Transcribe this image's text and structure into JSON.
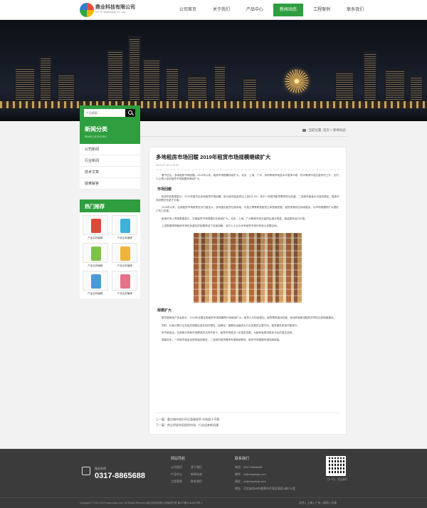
{
  "header": {
    "company_name": "鼎业科技有限公司",
    "company_sub": "Chi Ye Technology Co., Ltd.",
    "nav": [
      "公司首页",
      "关于我们",
      "产品中心",
      "新闻动态",
      "工程案例",
      "联系我们"
    ],
    "active_nav": "新闻动态"
  },
  "search": {
    "placeholder": "产品搜索"
  },
  "sidebar": {
    "title": "新闻分类",
    "subtitle": "NEWS CATEGORY",
    "items": [
      "公司新闻",
      "行业新闻",
      "技术文章",
      "疑难解答"
    ],
    "hot_title": "热门推荐",
    "products": [
      {
        "label": "产品名称编辑",
        "color": "#d94b3c"
      },
      {
        "label": "产品名称编辑",
        "color": "#3fb0d9"
      },
      {
        "label": "产品名称编辑",
        "color": "#7fc24b"
      },
      {
        "label": "产品名称编辑",
        "color": "#f0b43c"
      },
      {
        "label": "产品名称编辑",
        "color": "#4a9bd4"
      },
      {
        "label": "产品名称编辑",
        "color": "#e6728a"
      }
    ]
  },
  "breadcrumb": {
    "prefix": "当前位置:",
    "home": "首页",
    "current": "新闻动态"
  },
  "article": {
    "title": "多地租房市场回暖 2019年租赁市场规模继续扩大",
    "date": "2019-07-19 11:32:45",
    "intro": "春节过后，多地租房市场回暖。2019年以来，租房市场规模持续扩大，北京、上海、广州、深圳等城市租金水平整体平稳，杭州等城市成交量有所上升，业内人士预计全年租赁市场规模将继续扩大。",
    "section1": "市场回暖",
    "para1": "相关机构数据显示，2019年春节后多地租赁市场回暖，部分城市租金同比上涨约1.3%，其中一线城市租赁需求较为旺盛，二线城市租金水平保持稳定，整体市场供需关系趋于平衡。",
    "para2": "2019年以来，住房租赁市场政策支持力度加大，多地推出租赁住房用地，长租公寓等新型租赁主体快速发展，租赁房源供应持续增加，为市场规模的扩大提供了有力支撑。",
    "para3": "租房市场上季度数据显示，中国租赁市场规模仍在继续扩大，北京、上海、广州等城市成交量同比增长明显，租金整体运行平稳。",
    "para4": "上述数据表明租房市场在多重利好因素带动下持续回暖，业内人士认为未来租赁市场仍有较大发展空间。",
    "section2": "规模扩大",
    "para5": "据中国房地产协会统计，2019年全国住房租赁市场规模预计将继续扩大，租赁人口持续增加，租赁需求保持旺盛，各地积极推进租购并举的住房制度建设。",
    "para6": "同时，长租公寓行业在经历调整后逐步回归理性，品牌化、规模化运营成为行业发展的主要方向，租赁服务质量不断提升。",
    "para7": "有专家指出，在政策引导和市场需求的共同作用下，租赁市场将进一步规范发展，为租房者提供更多元化的居住选择。",
    "para8": "展望全年，一线城市租金走势将保持稳定，二线城市租赁需求有望继续释放，租赁市场规模有望突破新高。",
    "prev": "上一篇：重点城市房价环比涨幅收窄 市场趋于平稳",
    "next": "下一篇：房企积极布局租赁市场，行业迎来新机遇"
  },
  "footer": {
    "service_label": "服务热线",
    "phone": "0317-8865688",
    "nav_title": "网站导航",
    "nav_links": [
      "公司首页",
      "关于我们",
      "产品中心",
      "新闻动态",
      "工程案例",
      "联系我们"
    ],
    "contact_title": "联系我们",
    "contact": [
      "电话：0317-8865688",
      "邮件：wl@chiyekeji.com",
      "网址：wl@chiyekeji.com",
      "地址：河北省沧州市黄骅市开发区园区A座711室"
    ],
    "qr_label": "扫一扫，关注我们",
    "copyright": "Copyright © 2011-2019 www.chiye.com, All Rights Reserved  鼎业科技有限公司版权所有  冀ICP备12345678号-1",
    "cities": [
      "北京",
      "上海",
      "广州",
      "深圳",
      "天津"
    ]
  }
}
